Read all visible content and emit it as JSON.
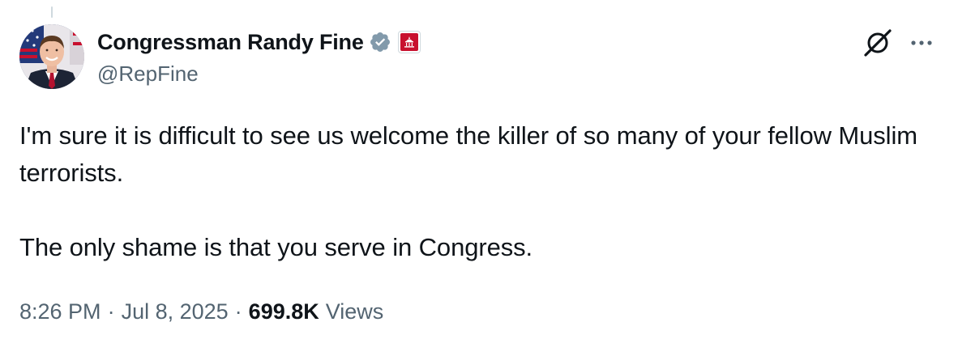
{
  "author": {
    "display_name": "Congressman Randy Fine",
    "handle": "@RepFine",
    "verified_badge_icon": "verified-badge-icon",
    "affiliate_badge_icon": "us-house-affiliate-icon",
    "verified_color": "#829aab",
    "affiliate_color": "#c8102e"
  },
  "tweet": {
    "paragraphs": [
      "I'm sure it is difficult to see us welcome the killer of so many of your fellow Muslim terrorists.",
      "The only shame is that you serve in Congress."
    ]
  },
  "meta": {
    "time": "8:26 PM",
    "separator": "·",
    "date": "Jul 8, 2025",
    "views_count": "699.8K",
    "views_label": "Views"
  },
  "actions": {
    "grok_icon": "grok-icon",
    "more_icon": "more-options-icon"
  },
  "colors": {
    "text_primary": "#0f1419",
    "text_secondary": "#536471"
  }
}
